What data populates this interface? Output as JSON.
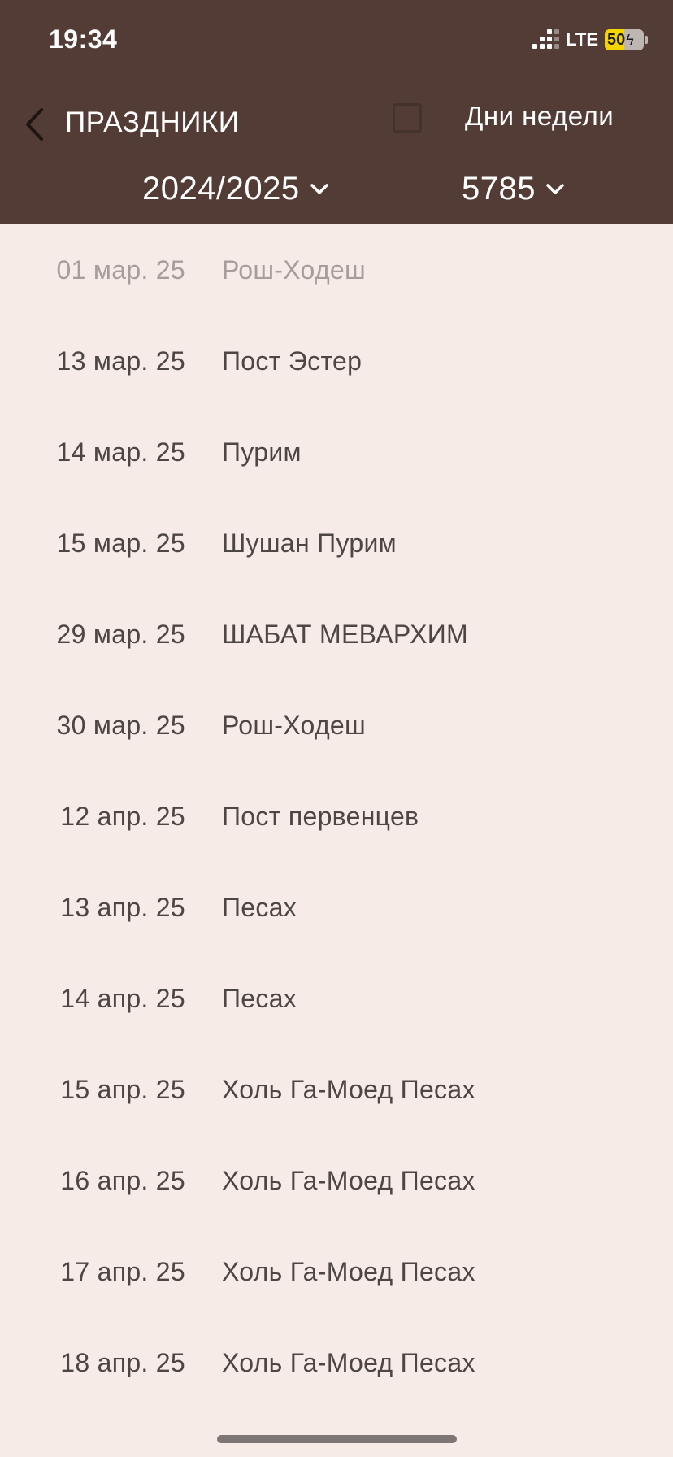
{
  "status_bar": {
    "time": "19:34",
    "network": "LTE",
    "battery": "50",
    "battery_level": 0.5,
    "battery_color": "#f5d400"
  },
  "header": {
    "title": "ПРАЗДНИКИ",
    "back_icon": "chevron-left-icon",
    "weekdays_label": "Дни недели",
    "weekdays_checked": false,
    "year_value": "2024/2025",
    "hebrew_year_value": "5785",
    "background": "#533c35"
  },
  "holidays": [
    {
      "date": "01 мар. 25",
      "name": "Рош-Ходеш",
      "past": true
    },
    {
      "date": "13 мар. 25",
      "name": "Пост Эстер",
      "past": false
    },
    {
      "date": "14 мар. 25",
      "name": "Пурим",
      "past": false
    },
    {
      "date": "15 мар. 25",
      "name": "Шушан Пурим",
      "past": false
    },
    {
      "date": "29 мар. 25",
      "name": "ШАБАТ МЕВАРХИМ",
      "past": false
    },
    {
      "date": "30 мар. 25",
      "name": "Рош-Ходеш",
      "past": false
    },
    {
      "date": "12 апр. 25",
      "name": "Пост первенцев",
      "past": false
    },
    {
      "date": "13 апр. 25",
      "name": "Песах",
      "past": false
    },
    {
      "date": "14 апр. 25",
      "name": "Песах",
      "past": false
    },
    {
      "date": "15 апр. 25",
      "name": "Холь Га-Моед Песах",
      "past": false
    },
    {
      "date": "16 апр. 25",
      "name": "Холь Га-Моед Песах",
      "past": false
    },
    {
      "date": "17 апр. 25",
      "name": "Холь Га-Моед Песах",
      "past": false
    },
    {
      "date": "18 апр. 25",
      "name": "Холь Га-Моед Песах",
      "past": false
    }
  ]
}
